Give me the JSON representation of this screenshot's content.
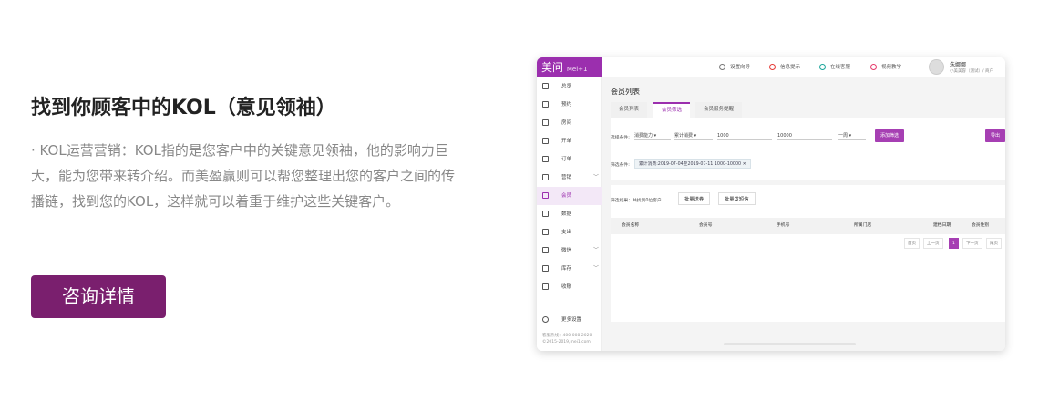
{
  "hero": {
    "title": "找到你顾客中的KOL（意见领袖）",
    "description": "· KOL运营营销：KOL指的是您客户中的关键意见领袖，他的影响力巨大，能为您带来转介绍。而美盈赢则可以帮您整理出您的客户之间的传播链，找到您的KOL，这样就可以着重于维护这些关键客户。",
    "cta_label": "咨询详情"
  },
  "app": {
    "logo": "美问",
    "logo_sub": "Mei+1",
    "topnav": [
      "设置向导",
      "信息提示",
      "在线客服",
      "视频教学"
    ],
    "user_name": "朱娜娜",
    "user_shop": "小美美容（测试）/ 商户",
    "sidebar": [
      {
        "label": "总览",
        "chevron": false,
        "active": false
      },
      {
        "label": "预约",
        "chevron": false,
        "active": false
      },
      {
        "label": "房间",
        "chevron": false,
        "active": false
      },
      {
        "label": "开单",
        "chevron": false,
        "active": false
      },
      {
        "label": "订单",
        "chevron": false,
        "active": false
      },
      {
        "label": "营销",
        "chevron": true,
        "active": false
      },
      {
        "label": "会员",
        "chevron": false,
        "active": true
      },
      {
        "label": "数据",
        "chevron": false,
        "active": false
      },
      {
        "label": "支出",
        "chevron": false,
        "active": false
      },
      {
        "label": "微信",
        "chevron": true,
        "active": false
      },
      {
        "label": "库存",
        "chevron": true,
        "active": false
      },
      {
        "label": "收账",
        "chevron": false,
        "active": false
      }
    ],
    "more_settings": "更多设置",
    "hotline": "客服热线：400-008-2020",
    "copyright": "©2015-2019,mei1.com",
    "page_title": "会员列表",
    "tabs": [
      {
        "label": "会员列表",
        "active": false
      },
      {
        "label": "会员筛选",
        "active": true
      },
      {
        "label": "会员服务提醒",
        "active": false
      }
    ],
    "filter": {
      "label": "选择条件:",
      "field1": "消费能力",
      "field2": "累计消费",
      "value_min": "1000",
      "value_max": "10000",
      "period": "一周",
      "add_button": "添加筛选",
      "export_button": "导出",
      "conditions_label": "筛选条件:",
      "condition_chip": "累计消费:2019-07-04至2019-07-11 1000-10000"
    },
    "results": {
      "summary": "筛选结果：共找到0位客户",
      "bulk_coupon": "批量送券",
      "bulk_sms": "批量发短信",
      "columns": [
        "会员名称",
        "会员号",
        "手机号",
        "所属门店",
        "建档日期",
        "会员性别"
      ],
      "pager": [
        "首页",
        "上一页",
        "1",
        "下一页",
        "尾页"
      ]
    }
  }
}
